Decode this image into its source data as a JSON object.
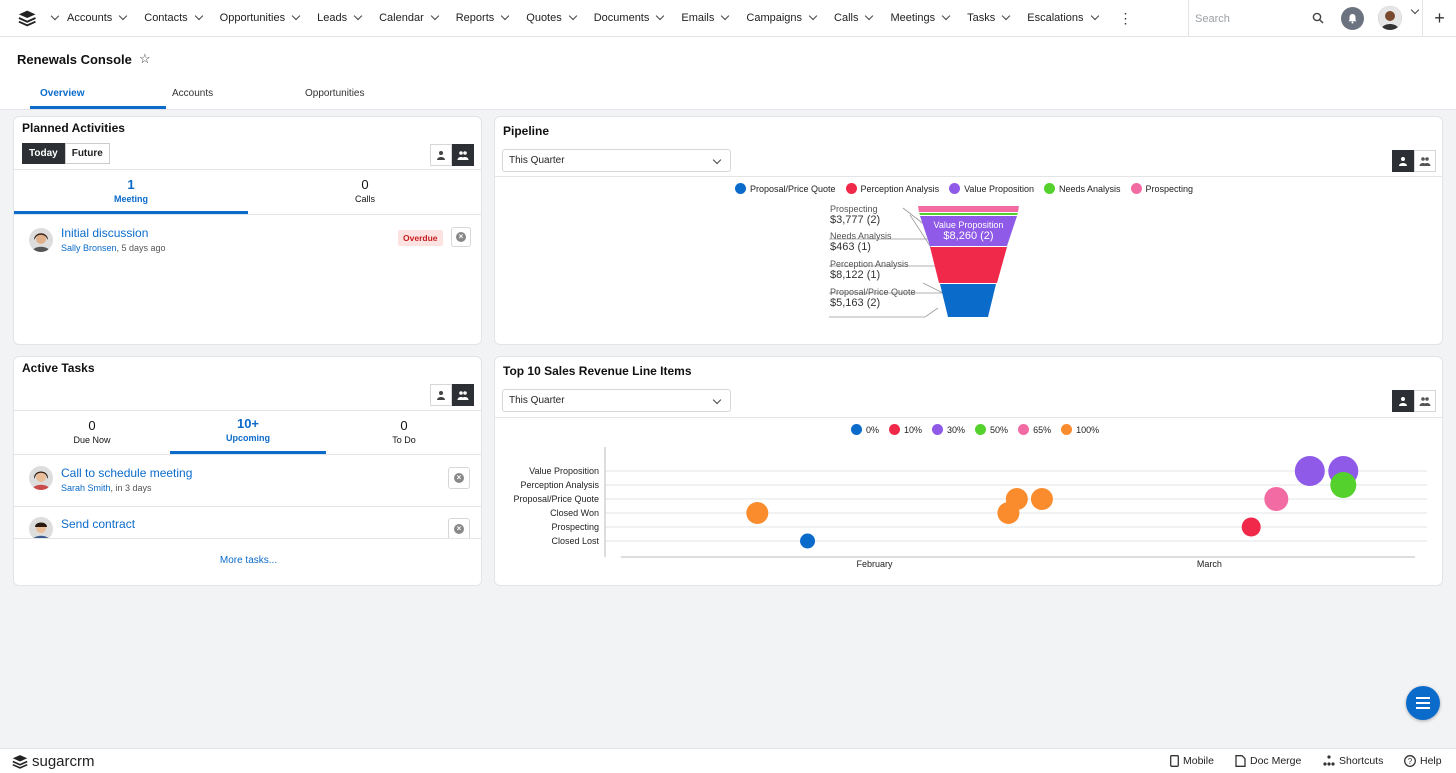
{
  "nav": {
    "items": [
      "Accounts",
      "Contacts",
      "Opportunities",
      "Leads",
      "Calendar",
      "Reports",
      "Quotes",
      "Documents",
      "Emails",
      "Campaigns",
      "Calls",
      "Meetings",
      "Tasks",
      "Escalations"
    ],
    "search_placeholder": "Search"
  },
  "header": {
    "title": "Renewals Console",
    "tabs": [
      "Overview",
      "Accounts",
      "Opportunities"
    ]
  },
  "planned": {
    "title": "Planned Activities",
    "toggle": [
      "Today",
      "Future"
    ],
    "stats": [
      {
        "n": "1",
        "l": "Meeting"
      },
      {
        "n": "0",
        "l": "Calls"
      }
    ],
    "row": {
      "title": "Initial discussion",
      "user": "Sally Bronsen",
      "time": ", 5 days ago",
      "badge": "Overdue"
    }
  },
  "tasks": {
    "title": "Active Tasks",
    "stats": [
      {
        "n": "0",
        "l": "Due Now"
      },
      {
        "n": "10+",
        "l": "Upcoming"
      },
      {
        "n": "0",
        "l": "To Do"
      }
    ],
    "rows": [
      {
        "title": "Call to schedule meeting",
        "user": "Sarah Smith",
        "time": ", in 3 days"
      },
      {
        "title": "Send contract"
      }
    ],
    "more": "More tasks..."
  },
  "pipeline": {
    "title": "Pipeline",
    "filter": "This Quarter",
    "legend": [
      {
        "label": "Proposal/Price Quote",
        "color": "#0b6bcb"
      },
      {
        "label": "Perception Analysis",
        "color": "#f0294a"
      },
      {
        "label": "Value Proposition",
        "color": "#8f5ae8"
      },
      {
        "label": "Needs Analysis",
        "color": "#55d12e"
      },
      {
        "label": "Prospecting",
        "color": "#f26ba3"
      }
    ],
    "funnel": [
      {
        "name": "Prospecting",
        "value": "$3,777 (2)"
      },
      {
        "name": "Needs Analysis",
        "value": "$463 (1)"
      },
      {
        "name": "Perception Analysis",
        "value": "$8,122 (1)"
      },
      {
        "name": "Proposal/Price Quote",
        "value": "$5,163 (2)"
      }
    ],
    "inner_label": {
      "name": "Value Proposition",
      "value": "$8,260 (2)"
    }
  },
  "revenue": {
    "title": "Top 10 Sales Revenue Line Items",
    "filter": "This Quarter",
    "legend": [
      {
        "label": "0%",
        "color": "#0b6bcb"
      },
      {
        "label": "10%",
        "color": "#f0294a"
      },
      {
        "label": "30%",
        "color": "#8f5ae8"
      },
      {
        "label": "50%",
        "color": "#55d12e"
      },
      {
        "label": "65%",
        "color": "#f26ba3"
      },
      {
        "label": "100%",
        "color": "#fb8c2e"
      }
    ]
  },
  "chart_data": {
    "type": "scatter",
    "title": "Top 10 Sales Revenue Line Items",
    "categories": [
      "Value Proposition",
      "Perception Analysis",
      "Proposal/Price Quote",
      "Closed Won",
      "Prospecting",
      "Closed Lost"
    ],
    "x_ticks": [
      "February",
      "March"
    ],
    "points": [
      {
        "x": "2024-02-02",
        "y": "Closed Won",
        "prob": "100%"
      },
      {
        "x": "2024-02-08",
        "y": "Closed Lost",
        "prob": "0%"
      },
      {
        "x": "2024-03-03",
        "y": "Closed Won",
        "prob": "100%"
      },
      {
        "x": "2024-03-04",
        "y": "Proposal/Price Quote",
        "prob": "100%"
      },
      {
        "x": "2024-03-07",
        "y": "Proposal/Price Quote",
        "prob": "100%"
      },
      {
        "x": "2024-04-01",
        "y": "Prospecting",
        "prob": "10%"
      },
      {
        "x": "2024-04-04",
        "y": "Proposal/Price Quote",
        "prob": "65%"
      },
      {
        "x": "2024-04-08",
        "y": "Value Proposition",
        "prob": "30%"
      },
      {
        "x": "2024-04-12",
        "y": "Value Proposition",
        "prob": "30%"
      },
      {
        "x": "2024-04-12",
        "y": "Perception Analysis",
        "prob": "50%"
      }
    ]
  },
  "footer": {
    "brand": "sugarcrm",
    "links": [
      "Mobile",
      "Doc Merge",
      "Shortcuts",
      "Help"
    ]
  }
}
